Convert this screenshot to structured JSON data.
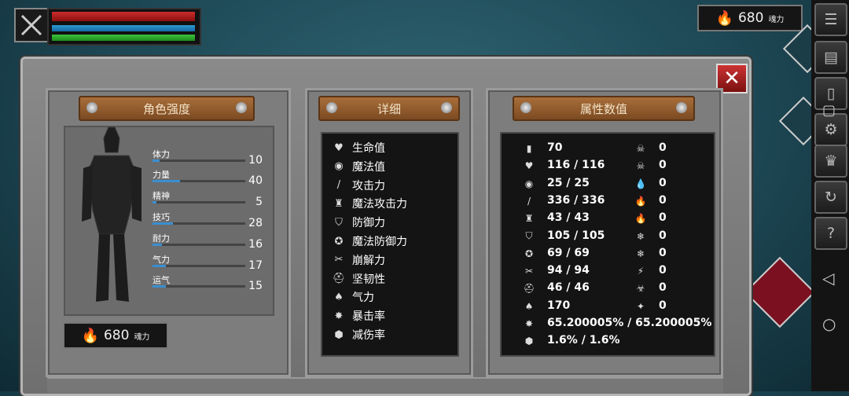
{
  "soul_currency": {
    "amount": "680",
    "unit": "魂力"
  },
  "panels": {
    "character": {
      "title": "角色强度"
    },
    "details": {
      "title": "详细"
    },
    "attributes": {
      "title": "属性数值"
    }
  },
  "stats": [
    {
      "label": "体力",
      "value": "10",
      "fill": 0.08
    },
    {
      "label": "力量",
      "value": "40",
      "fill": 0.3
    },
    {
      "label": "精神",
      "value": "5",
      "fill": 0.04
    },
    {
      "label": "技巧",
      "value": "28",
      "fill": 0.22
    },
    {
      "label": "耐力",
      "value": "16",
      "fill": 0.1
    },
    {
      "label": "气力",
      "value": "17",
      "fill": 0.14
    },
    {
      "label": "运气",
      "value": "15",
      "fill": 0.14
    }
  ],
  "detail_items": [
    {
      "label": "生命值",
      "icon": "heart-icon"
    },
    {
      "label": "魔法值",
      "icon": "brain-icon"
    },
    {
      "label": "攻击力",
      "icon": "sword-icon"
    },
    {
      "label": "魔法攻击力",
      "icon": "crown-icon"
    },
    {
      "label": "防御力",
      "icon": "shield-icon"
    },
    {
      "label": "魔法防御力",
      "icon": "magic-shield-icon"
    },
    {
      "label": "崩解力",
      "icon": "break-icon"
    },
    {
      "label": "坚韧性",
      "icon": "helmet-icon"
    },
    {
      "label": "气力",
      "icon": "lungs-icon"
    },
    {
      "label": "暴击率",
      "icon": "burst-icon"
    },
    {
      "label": "减伤率",
      "icon": "guard-icon"
    }
  ],
  "attribute_values": [
    "70",
    "116 / 116",
    "25 / 25",
    "336 / 336",
    "43 / 43",
    "105 / 105",
    "69 / 69",
    "94 / 94",
    "46 / 46",
    "170",
    "65.200005% / 65.200005%",
    "1.6% / 1.6%"
  ],
  "resistances": [
    "0",
    "0",
    "0",
    "0",
    "0",
    "0",
    "0",
    "0",
    "0",
    "0"
  ],
  "colors": {
    "hp": "#c92c2c",
    "mp": "#2d9ad1",
    "stamina": "#3cc23c",
    "plank": "#a86e3a",
    "close": "#c33"
  }
}
